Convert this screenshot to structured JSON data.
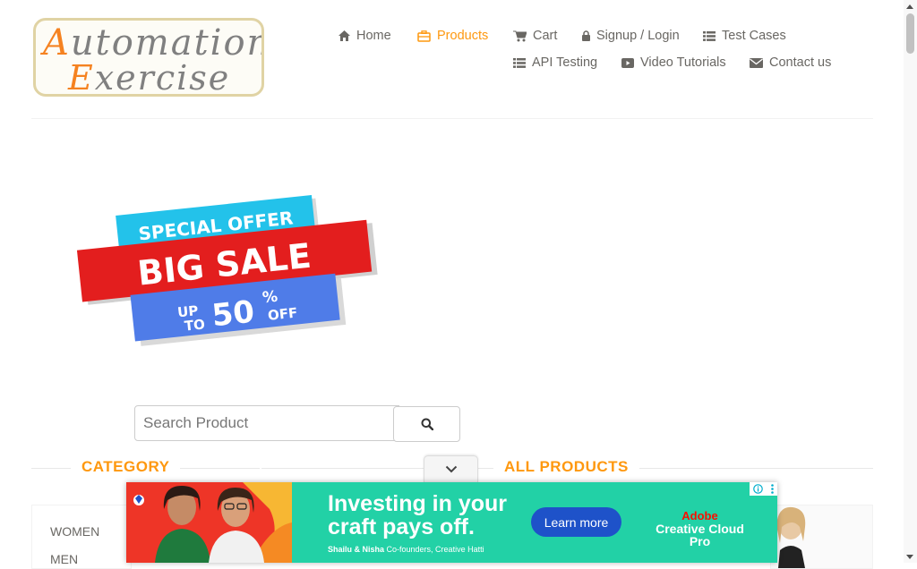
{
  "logo": {
    "line1_cap": "A",
    "line1_rest": "utomation",
    "line2_cap": "E",
    "line2_rest": "xercise"
  },
  "nav": {
    "home": "Home",
    "products": "Products",
    "cart": "Cart",
    "signup_login": "Signup / Login",
    "test_cases": "Test Cases",
    "api_testing": "API Testing",
    "video_tutorials": "Video Tutorials",
    "contact_us": "Contact us"
  },
  "banner": {
    "line1": "SPECIAL OFFER",
    "line2": "BIG SALE",
    "up": "UP",
    "to": "TO",
    "amount": "50",
    "percent": "%",
    "off": "OFF"
  },
  "search": {
    "placeholder": "Search Product",
    "value": ""
  },
  "sections": {
    "category": "CATEGORY",
    "all_products": "ALL PRODUCTS"
  },
  "categories": [
    "WOMEN",
    "MEN"
  ],
  "ad": {
    "headline_1": "Investing in your",
    "headline_2": "craft pays off.",
    "caption_names": "Shailu & Nisha",
    "caption_role": "Co-founders, Creative Hatti",
    "cta": "Learn more",
    "brand_1": "Adobe",
    "brand_2": "Creative Cloud Pro"
  },
  "colors": {
    "accent": "#fe980f",
    "nav_text": "#696763",
    "ad_bg": "#22d1a6",
    "ad_button": "#1e52c9",
    "adobe_red": "#fa0f00"
  }
}
